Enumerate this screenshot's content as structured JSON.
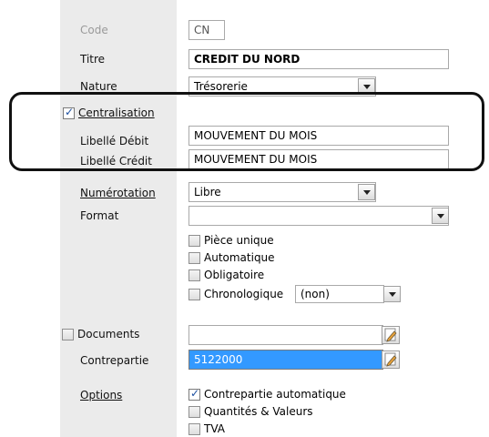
{
  "form": {
    "code": {
      "label": "Code",
      "value": "CN"
    },
    "titre": {
      "label": "Titre",
      "value": "CREDIT DU NORD"
    },
    "nature": {
      "label": "Nature",
      "value": "Trésorerie"
    },
    "centralisation": {
      "label": "Centralisation",
      "checked": true
    },
    "libelle_debit": {
      "label": "Libellé Débit",
      "value": "MOUVEMENT DU MOIS"
    },
    "libelle_credit": {
      "label": "Libellé Crédit",
      "value": "MOUVEMENT DU MOIS"
    },
    "numerotation": {
      "label": "Numérotation",
      "value": "Libre"
    },
    "format": {
      "label": "Format",
      "value": ""
    },
    "options_checks": [
      {
        "label": "Pièce unique",
        "checked": false
      },
      {
        "label": "Automatique",
        "checked": false
      },
      {
        "label": "Obligatoire",
        "checked": false
      },
      {
        "label": "Chronologique",
        "checked": false
      }
    ],
    "chronologique_select": "(non)",
    "documents": {
      "label": "Documents",
      "checked": false,
      "value": ""
    },
    "contrepartie": {
      "label": "Contrepartie",
      "value": "5122000"
    },
    "options": {
      "label": "Options"
    },
    "bottom_checks": [
      {
        "label": "Contrepartie automatique",
        "checked": true
      },
      {
        "label": "Quantités & Valeurs",
        "checked": false
      },
      {
        "label": "TVA",
        "checked": false
      }
    ]
  }
}
